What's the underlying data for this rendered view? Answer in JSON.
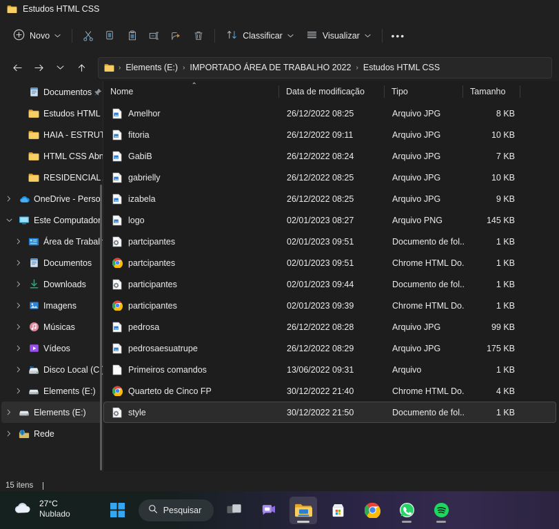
{
  "window": {
    "title": "Estudos HTML CSS",
    "title_icon": "folder-icon"
  },
  "toolbar": {
    "new_label": "Novo",
    "sort_label": "Classificar",
    "view_label": "Visualizar",
    "more_label": "•••",
    "icons": [
      {
        "name": "cut-icon",
        "tooltip": "Recortar"
      },
      {
        "name": "copy-icon",
        "tooltip": "Copiar"
      },
      {
        "name": "paste-icon",
        "tooltip": "Colar"
      },
      {
        "name": "rename-icon",
        "tooltip": "Renomear"
      },
      {
        "name": "share-icon",
        "tooltip": "Compartilhar"
      },
      {
        "name": "delete-icon",
        "tooltip": "Excluir"
      }
    ]
  },
  "address": {
    "back": "←",
    "forward": "→",
    "recent": "⌄",
    "up": "↑",
    "crumbs": [
      "Elements (E:)",
      "IMPORTADO ÁREA DE TRABALHO 2022",
      "Estudos HTML CSS"
    ],
    "separator": "›"
  },
  "sidebar": {
    "items": [
      {
        "label": "Documentos",
        "icon": "documents-icon",
        "indent": 1,
        "twisty": "",
        "pinned": true,
        "selected": false
      },
      {
        "label": "Estudos HTML C",
        "icon": "folder-icon",
        "indent": 1,
        "twisty": "",
        "pinned": false,
        "selected": false
      },
      {
        "label": "HAIA - ESTRUTU",
        "icon": "folder-icon",
        "indent": 1,
        "twisty": "",
        "pinned": false,
        "selected": false
      },
      {
        "label": "HTML CSS Abn",
        "icon": "folder-icon",
        "indent": 1,
        "twisty": "",
        "pinned": false,
        "selected": false
      },
      {
        "label": "RESIDENCIAL A",
        "icon": "folder-icon",
        "indent": 1,
        "twisty": "",
        "pinned": false,
        "selected": false
      },
      {
        "label": "OneDrive - Perso",
        "icon": "onedrive-icon",
        "indent": 0,
        "twisty": "collapsed",
        "pinned": false,
        "selected": false
      },
      {
        "label": "Este Computador",
        "icon": "computer-icon",
        "indent": 0,
        "twisty": "expanded",
        "pinned": false,
        "selected": false
      },
      {
        "label": "Área de Trabalh",
        "icon": "desktop-icon",
        "indent": 1,
        "twisty": "collapsed",
        "pinned": false,
        "selected": false
      },
      {
        "label": "Documentos",
        "icon": "documents-icon",
        "indent": 1,
        "twisty": "collapsed",
        "pinned": false,
        "selected": false
      },
      {
        "label": "Downloads",
        "icon": "downloads-icon",
        "indent": 1,
        "twisty": "collapsed",
        "pinned": false,
        "selected": false
      },
      {
        "label": "Imagens",
        "icon": "pictures-icon",
        "indent": 1,
        "twisty": "collapsed",
        "pinned": false,
        "selected": false
      },
      {
        "label": "Músicas",
        "icon": "music-icon",
        "indent": 1,
        "twisty": "collapsed",
        "pinned": false,
        "selected": false
      },
      {
        "label": "Vídeos",
        "icon": "videos-icon",
        "indent": 1,
        "twisty": "collapsed",
        "pinned": false,
        "selected": false
      },
      {
        "label": "Disco Local (C:)",
        "icon": "drive-icon",
        "indent": 1,
        "twisty": "collapsed",
        "pinned": false,
        "selected": false
      },
      {
        "label": "Elements (E:)",
        "icon": "usb-drive-icon",
        "indent": 1,
        "twisty": "collapsed",
        "pinned": false,
        "selected": false
      },
      {
        "label": "Elements (E:)",
        "icon": "usb-drive-icon",
        "indent": 0,
        "twisty": "collapsed",
        "pinned": false,
        "selected": true
      },
      {
        "label": "Rede",
        "icon": "network-icon",
        "indent": 0,
        "twisty": "collapsed",
        "pinned": false,
        "selected": false
      }
    ]
  },
  "columns": {
    "name": "Nome",
    "date": "Data de modificação",
    "type": "Tipo",
    "size": "Tamanho",
    "sort_caret": "⌃"
  },
  "files": [
    {
      "name": "Amelhor",
      "date": "26/12/2022 08:25",
      "type": "Arquivo JPG",
      "size": "8 KB",
      "icon": "image-file-icon",
      "selected": false
    },
    {
      "name": "fitoria",
      "date": "26/12/2022 09:11",
      "type": "Arquivo JPG",
      "size": "10 KB",
      "icon": "image-file-icon",
      "selected": false
    },
    {
      "name": "GabiB",
      "date": "26/12/2022 08:24",
      "type": "Arquivo JPG",
      "size": "7 KB",
      "icon": "image-file-icon",
      "selected": false
    },
    {
      "name": "gabrielly",
      "date": "26/12/2022 08:25",
      "type": "Arquivo JPG",
      "size": "10 KB",
      "icon": "image-file-icon",
      "selected": false
    },
    {
      "name": "izabela",
      "date": "26/12/2022 08:25",
      "type": "Arquivo JPG",
      "size": "9 KB",
      "icon": "image-file-icon",
      "selected": false
    },
    {
      "name": "logo",
      "date": "02/01/2023 08:27",
      "type": "Arquivo PNG",
      "size": "145 KB",
      "icon": "image-file-icon",
      "selected": false
    },
    {
      "name": "partcipantes",
      "date": "02/01/2023 09:51",
      "type": "Documento de fol...",
      "size": "1 KB",
      "icon": "css-file-icon",
      "selected": false
    },
    {
      "name": "partcipantes",
      "date": "02/01/2023 09:51",
      "type": "Chrome HTML Do...",
      "size": "1 KB",
      "icon": "chrome-icon",
      "selected": false
    },
    {
      "name": "participantes",
      "date": "02/01/2023 09:44",
      "type": "Documento de fol...",
      "size": "1 KB",
      "icon": "css-file-icon",
      "selected": false
    },
    {
      "name": "participantes",
      "date": "02/01/2023 09:39",
      "type": "Chrome HTML Do...",
      "size": "1 KB",
      "icon": "chrome-icon",
      "selected": false
    },
    {
      "name": "pedrosa",
      "date": "26/12/2022 08:28",
      "type": "Arquivo JPG",
      "size": "99 KB",
      "icon": "image-file-icon",
      "selected": false
    },
    {
      "name": "pedrosaesuatrupe",
      "date": "26/12/2022 08:29",
      "type": "Arquivo JPG",
      "size": "175 KB",
      "icon": "image-file-icon",
      "selected": false
    },
    {
      "name": "Primeiros comandos",
      "date": "13/06/2022 09:31",
      "type": "Arquivo",
      "size": "1 KB",
      "icon": "blank-file-icon",
      "selected": false
    },
    {
      "name": "Quarteto de Cinco FP",
      "date": "30/12/2022 21:40",
      "type": "Chrome HTML Do...",
      "size": "4 KB",
      "icon": "chrome-icon",
      "selected": false
    },
    {
      "name": "style",
      "date": "30/12/2022 21:50",
      "type": "Documento de fol...",
      "size": "1 KB",
      "icon": "css-file-icon",
      "selected": true
    }
  ],
  "status": {
    "item_count": "15 itens"
  },
  "taskbar": {
    "weather": {
      "temperature": "27°C",
      "condition": "Nublado",
      "icon": "cloud-icon"
    },
    "search_label": "Pesquisar",
    "items": [
      {
        "name": "start-button",
        "label": "Iniciar"
      },
      {
        "name": "task-view-button",
        "label": "Visão de tarefas"
      },
      {
        "name": "teams-button",
        "label": "Microsoft Teams"
      },
      {
        "name": "file-explorer-button",
        "label": "Explorador de Arquivos"
      },
      {
        "name": "microsoft-store-button",
        "label": "Microsoft Store"
      },
      {
        "name": "chrome-button",
        "label": "Google Chrome"
      },
      {
        "name": "whatsapp-button",
        "label": "WhatsApp"
      },
      {
        "name": "spotify-button",
        "label": "Spotify"
      }
    ]
  },
  "colors": {
    "window_bg": "#202020",
    "list_bg": "#1d1d1d",
    "folder_yellow": "#f2c14b",
    "accent_blue": "#4aa3df",
    "selection": "#2c2c2c"
  }
}
